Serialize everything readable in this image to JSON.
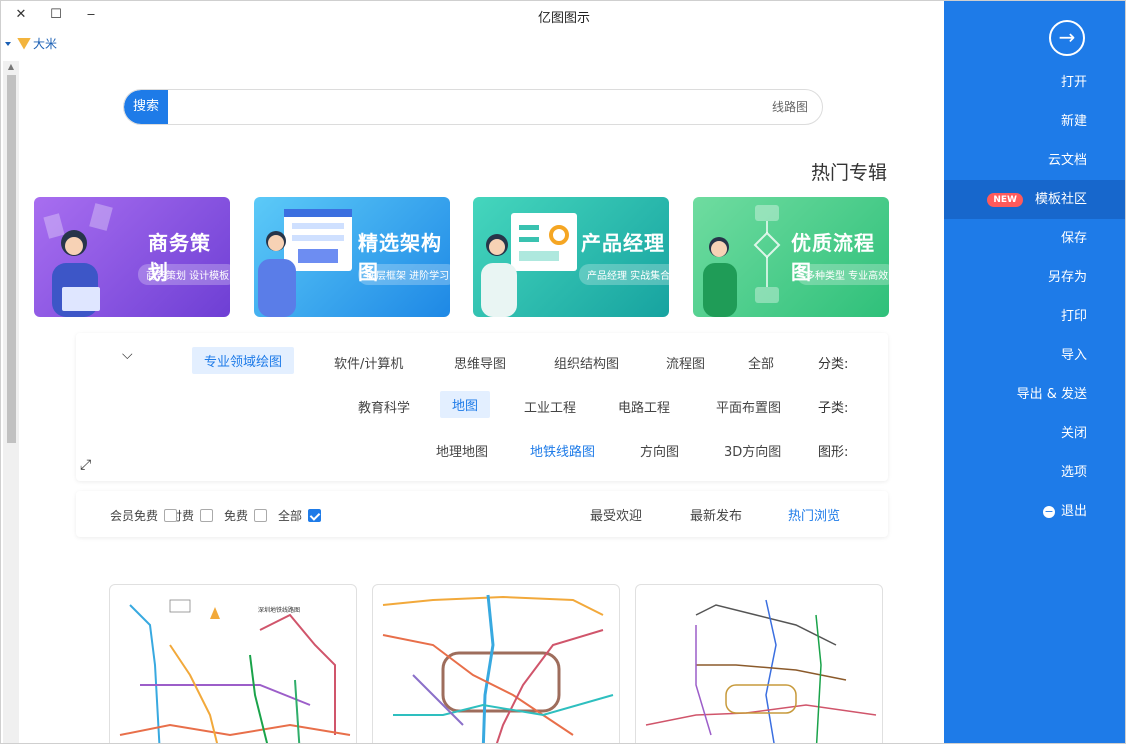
{
  "window": {
    "title": "亿图图示",
    "close": "✕",
    "maximize": "☐",
    "minimize": "‒"
  },
  "user": {
    "name": "大米"
  },
  "search": {
    "button": "搜索",
    "placeholder": "线路图"
  },
  "hot_topics": {
    "title": "热门专辑",
    "banners": [
      {
        "title": "优质流程图",
        "subtitle": "多种类型 专业高效",
        "colors": [
          "#5ed18e",
          "#2fc07a"
        ]
      },
      {
        "title": "产品经理",
        "subtitle": "产品经理 实战集合",
        "colors": [
          "#38cfb5",
          "#1aa9a6"
        ]
      },
      {
        "title": "精选架构图",
        "subtitle": "底层框架 进阶学习",
        "colors": [
          "#4fc3f7",
          "#1e88e5"
        ]
      },
      {
        "title": "商务策划",
        "subtitle": "商务策划 设计模板",
        "colors": [
          "#9a63e8",
          "#7142d6"
        ]
      }
    ]
  },
  "filters": {
    "category": {
      "label": "分类:",
      "options": [
        "全部",
        "流程图",
        "组织结构图",
        "思维导图",
        "软件/计算机",
        "专业领域绘图"
      ],
      "selected": "专业领域绘图"
    },
    "subcategory": {
      "label": "子类:",
      "options": [
        "平面布置图",
        "电路工程",
        "工业工程",
        "地图",
        "教育科学"
      ],
      "selected": "地图"
    },
    "shape": {
      "label": "图形:",
      "options": [
        "3D方向图",
        "方向图",
        "地铁线路图",
        "地理地图"
      ],
      "highlighted": "地铁线路图"
    }
  },
  "sort": {
    "tabs": [
      "热门浏览",
      "最新发布",
      "最受欢迎"
    ],
    "active": "热门浏览",
    "price_filters": [
      {
        "label": "全部",
        "checked": true
      },
      {
        "label": "免费",
        "checked": false
      },
      {
        "label": "付费",
        "checked": false
      },
      {
        "label": "会员免费",
        "checked": false
      }
    ]
  },
  "templates": [
    {
      "title": "深圳地铁线路图"
    },
    {
      "title": ""
    },
    {
      "title": ""
    }
  ],
  "sidebar": {
    "items": [
      {
        "label": "打开"
      },
      {
        "label": "新建"
      },
      {
        "label": "云文档"
      },
      {
        "label": "模板社区",
        "badge": "NEW",
        "active": true
      },
      {
        "label": "保存"
      },
      {
        "label": "另存为"
      },
      {
        "label": "打印"
      },
      {
        "label": "导入"
      },
      {
        "label": "导出 & 发送"
      },
      {
        "label": "关闭"
      },
      {
        "label": "选项"
      },
      {
        "label": "退出",
        "icon": "minus-circle-icon"
      }
    ]
  },
  "colors": {
    "accent": "#1e7be8",
    "sidebar_active": "#1767cc"
  }
}
